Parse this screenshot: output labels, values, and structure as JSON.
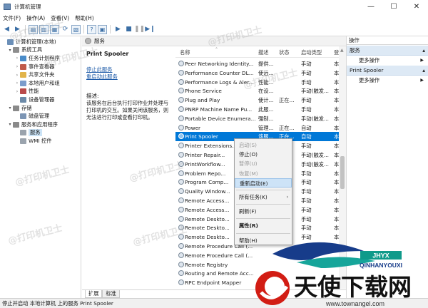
{
  "window": {
    "title": "计算机管理",
    "controls": {
      "minimize": "—",
      "maximize": "☐",
      "close": "✕"
    }
  },
  "menu": [
    "文件(F)",
    "操作(A)",
    "查看(V)",
    "帮助(H)"
  ],
  "tree": [
    {
      "label": "计算机管理(本地)",
      "expand": "",
      "icon": "computer-icon",
      "color": "#6b8fb8"
    },
    {
      "label": "系统工具",
      "expand": "▾",
      "icon": "tools-icon",
      "color": "#8d8d8d"
    },
    {
      "label": "任务计划程序",
      "expand": "›",
      "icon": "clock-icon",
      "color": "#4a8cc9"
    },
    {
      "label": "事件查看器",
      "expand": "›",
      "icon": "event-viewer-icon",
      "color": "#c05a4a"
    },
    {
      "label": "共享文件夹",
      "expand": "›",
      "icon": "shared-folder-icon",
      "color": "#e2b44a"
    },
    {
      "label": "本地用户和组",
      "expand": "›",
      "icon": "users-icon",
      "color": "#7a9ccc"
    },
    {
      "label": "性能",
      "expand": "›",
      "icon": "performance-icon",
      "color": "#b94a4a"
    },
    {
      "label": "设备管理器",
      "expand": "",
      "icon": "device-manager-icon",
      "color": "#6c8aa8"
    },
    {
      "label": "存储",
      "expand": "▾",
      "icon": "storage-icon",
      "color": "#8a8a8a"
    },
    {
      "label": "磁盘管理",
      "expand": "",
      "icon": "disk-icon",
      "color": "#7c95b4"
    },
    {
      "label": "服务和应用程序",
      "expand": "▾",
      "icon": "services-apps-icon",
      "color": "#8a8a8a"
    },
    {
      "label": "服务",
      "expand": "",
      "icon": "services-icon",
      "color": "#9aa3ad",
      "selected": true
    },
    {
      "label": "WMI 控件",
      "expand": "",
      "icon": "wmi-icon",
      "color": "#9aa3ad"
    }
  ],
  "center": {
    "header": "服务",
    "selected_service": "Print Spooler",
    "links": [
      "停止此服务",
      "重启动此服务"
    ],
    "desc_label": "描述:",
    "desc_text": "该服务在后台执行打印作业并处理与打印机的交互。如果关闭该服务，则无法进行打印或查看打印机。"
  },
  "columns": [
    "名称",
    "描述",
    "状态",
    "启动类型",
    "登"
  ],
  "services": [
    {
      "name": "Peer Networking Identity...",
      "desc": "提供...",
      "status": "",
      "startup": "手动",
      "logon": "本"
    },
    {
      "name": "Performance Counter DL...",
      "desc": "使远...",
      "status": "",
      "startup": "手动",
      "logon": "本"
    },
    {
      "name": "Performance Logs & Aler...",
      "desc": "性能...",
      "status": "",
      "startup": "手动",
      "logon": "本"
    },
    {
      "name": "Phone Service",
      "desc": "在设...",
      "status": "",
      "startup": "手动(触发...",
      "logon": "本"
    },
    {
      "name": "Plug and Play",
      "desc": "使计...",
      "status": "正在...",
      "startup": "手动",
      "logon": "本"
    },
    {
      "name": "PNRP Machine Name Pu...",
      "desc": "此服...",
      "status": "",
      "startup": "手动",
      "logon": "本"
    },
    {
      "name": "Portable Device Enumera...",
      "desc": "强制...",
      "status": "",
      "startup": "手动(触发...",
      "logon": "本"
    },
    {
      "name": "Power",
      "desc": "管理...",
      "status": "正在...",
      "startup": "自动",
      "logon": "本"
    },
    {
      "name": "Print Spooler",
      "desc": "该服...",
      "status": "正在...",
      "startup": "自动",
      "logon": "本",
      "selected": true
    },
    {
      "name": "Printer Extensions...",
      "desc": "",
      "status": "",
      "startup": "手动",
      "logon": "本"
    },
    {
      "name": "Printer Repair...",
      "desc": "",
      "status": "",
      "startup": "手动(触发...",
      "logon": "本"
    },
    {
      "name": "PrintWorkflow...",
      "desc": "",
      "status": "",
      "startup": "手动(触发...",
      "logon": "本"
    },
    {
      "name": "Problem Repo...",
      "desc": "",
      "status": "",
      "startup": "手动",
      "logon": "本"
    },
    {
      "name": "Program Comp...",
      "desc": "",
      "status": "",
      "startup": "手动",
      "logon": "本"
    },
    {
      "name": "Quality Window...",
      "desc": "",
      "status": "",
      "startup": "手动",
      "logon": "本"
    },
    {
      "name": "Remote Access...",
      "desc": "",
      "status": "",
      "startup": "手动",
      "logon": "本"
    },
    {
      "name": "Remote Access...",
      "desc": "",
      "status": "",
      "startup": "手动",
      "logon": "本"
    },
    {
      "name": "Remote Deskto...",
      "desc": "",
      "status": "",
      "startup": "手动",
      "logon": "本"
    },
    {
      "name": "Remote Deskto...",
      "desc": "",
      "status": "",
      "startup": "手动",
      "logon": "本"
    },
    {
      "name": "Remote Deskto...",
      "desc": "",
      "status": "",
      "startup": "手动",
      "logon": "本"
    },
    {
      "name": "Remote Procedure Call (...",
      "desc": "",
      "status": "",
      "startup": "",
      "logon": ""
    },
    {
      "name": "Remote Procedure Call (...",
      "desc": "",
      "status": "",
      "startup": "",
      "logon": ""
    },
    {
      "name": "Remote Registry",
      "desc": "",
      "status": "",
      "startup": "",
      "logon": ""
    },
    {
      "name": "Routing and Remote Acc...",
      "desc": "",
      "status": "",
      "startup": "",
      "logon": ""
    },
    {
      "name": "RPC Endpoint Mapper",
      "desc": "",
      "status": "",
      "startup": "",
      "logon": ""
    }
  ],
  "tabs": [
    "扩展",
    "标准"
  ],
  "actions": {
    "header": "操作",
    "sections": [
      {
        "title": "服务",
        "items": [
          "更多操作"
        ]
      },
      {
        "title": "Print Spooler",
        "items": [
          "更多操作"
        ]
      }
    ]
  },
  "context_menu": [
    {
      "label": "启动(S)",
      "disabled": true
    },
    {
      "label": "停止(O)"
    },
    {
      "label": "暂停(U)",
      "disabled": true
    },
    {
      "label": "恢复(M)",
      "disabled": true
    },
    {
      "label": "重新启动(E)",
      "highlighted": true
    },
    {
      "sep": true
    },
    {
      "label": "所有任务(K)",
      "submenu": true
    },
    {
      "sep": true
    },
    {
      "label": "刷新(F)"
    },
    {
      "sep": true
    },
    {
      "label": "属性(R)",
      "bold": true
    },
    {
      "sep": true
    },
    {
      "label": "帮助(H)"
    }
  ],
  "status_bar": "停止并启动 本地计算机 上的服务 Print Spooler",
  "watermarks": [
    "@打印机卫士",
    "@打印机卫士",
    "@打印机卫士",
    "@打印机卫士",
    "@打印机卫士",
    "@打印机卫士",
    "@打印机卫士",
    "@打印机卫士"
  ],
  "logo": {
    "brand": "QINHANYOUXI",
    "badge": "JHYX",
    "chinese": "天使下载网",
    "url": "www.townangel.com"
  }
}
